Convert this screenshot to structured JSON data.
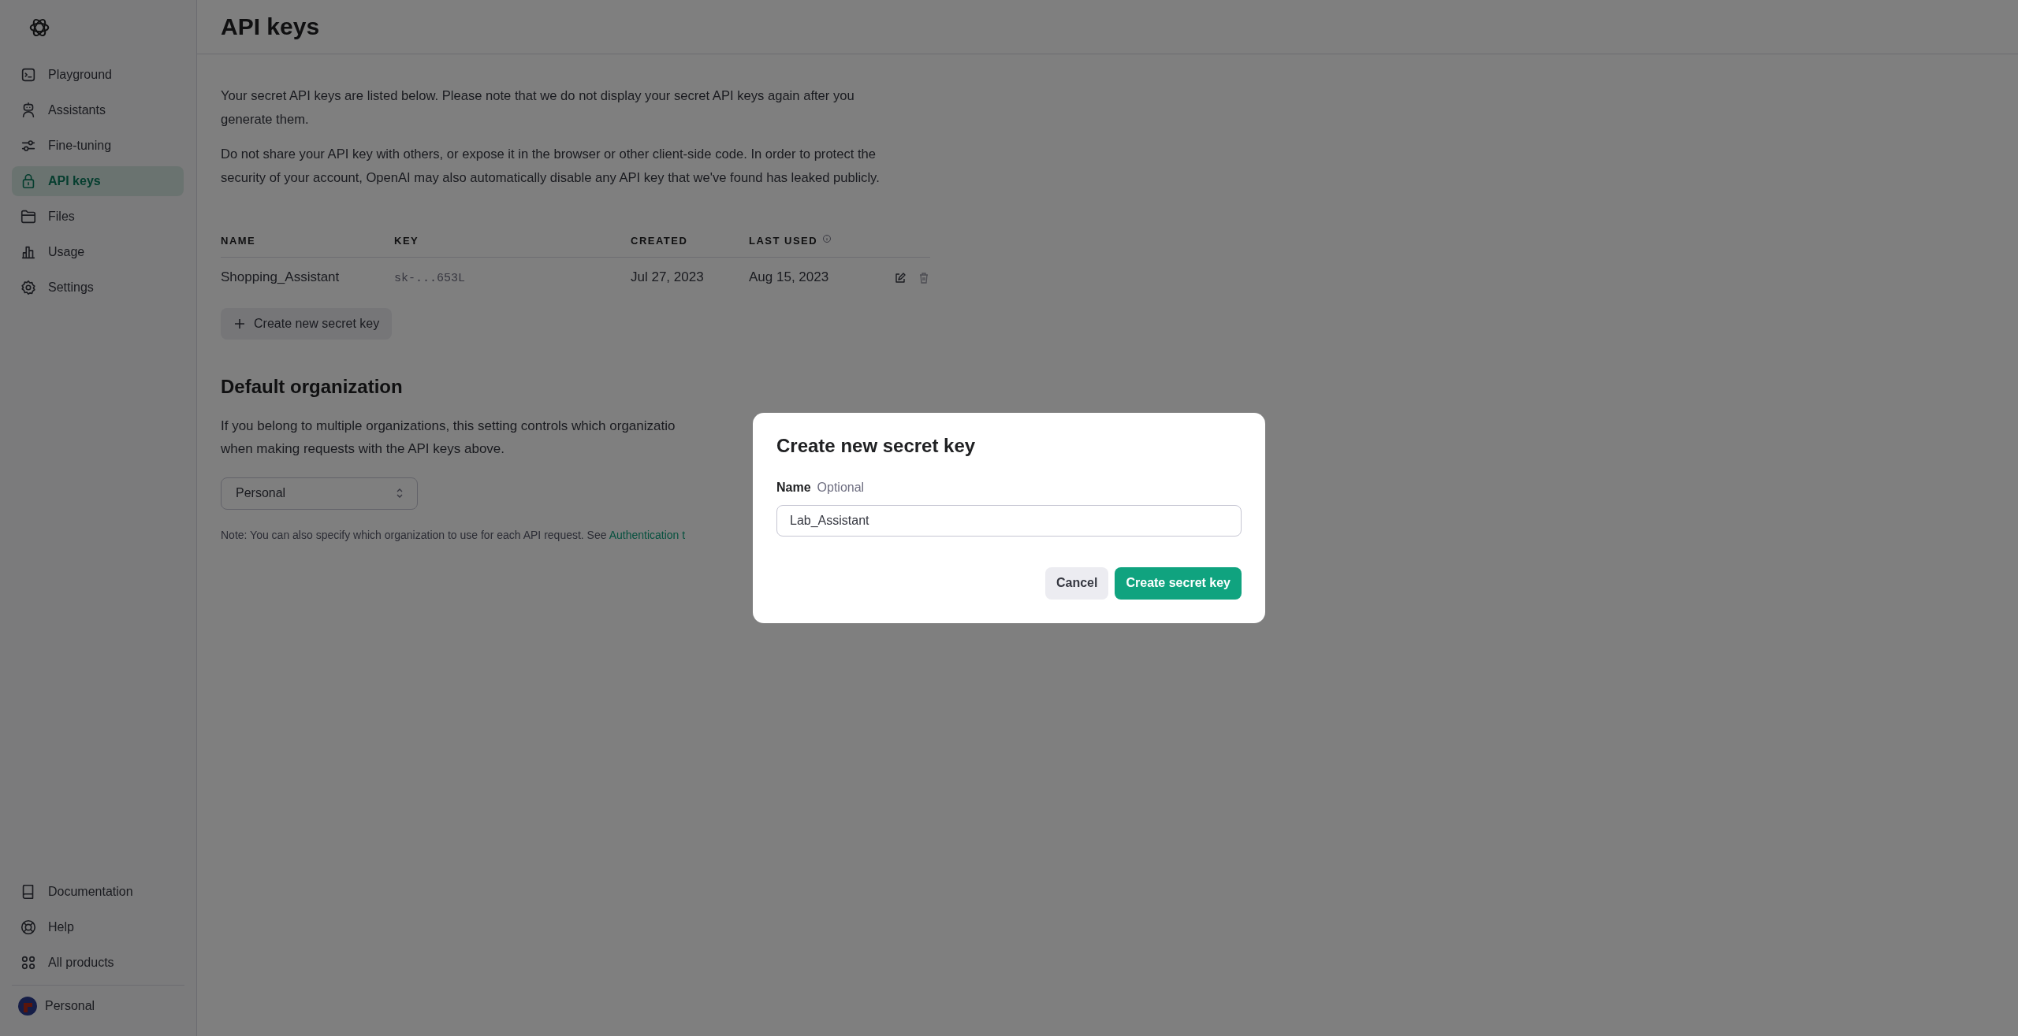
{
  "sidebar": {
    "items": [
      {
        "label": "Playground",
        "selected": false
      },
      {
        "label": "Assistants",
        "selected": false
      },
      {
        "label": "Fine-tuning",
        "selected": false
      },
      {
        "label": "API keys",
        "selected": true
      },
      {
        "label": "Files",
        "selected": false
      },
      {
        "label": "Usage",
        "selected": false
      },
      {
        "label": "Settings",
        "selected": false
      }
    ],
    "footer_items": [
      {
        "label": "Documentation"
      },
      {
        "label": "Help"
      },
      {
        "label": "All products"
      }
    ],
    "account": {
      "label": "Personal"
    }
  },
  "page": {
    "title": "API keys",
    "paragraphs": [
      "Your secret API keys are listed below. Please note that we do not display your secret API keys again after you generate them.",
      "Do not share your API key with others, or expose it in the browser or other client-side code. In order to protect the security of your account, OpenAI may also automatically disable any API key that we've found has leaked publicly."
    ],
    "table": {
      "columns": [
        {
          "label": "NAME",
          "info": false
        },
        {
          "label": "KEY",
          "info": false
        },
        {
          "label": "CREATED",
          "info": false
        },
        {
          "label": "LAST USED",
          "info": true
        }
      ],
      "rows": [
        {
          "name": "Shopping_Assistant",
          "key": "sk-...653L",
          "created": "Jul 27, 2023",
          "last_used": "Aug 15, 2023"
        }
      ]
    },
    "create_button": "Create new secret key",
    "org_section": {
      "title": "Default organization",
      "description_lines": [
        "If you belong to multiple organizations, this setting controls which organizatio",
        "when making requests with the API keys above."
      ],
      "select": {
        "value": "Personal"
      },
      "note": {
        "text": "Note: You can also specify which organization to use for each API request. See ",
        "link": "Authentication t"
      }
    }
  },
  "modal": {
    "title": "Create new secret key",
    "field": {
      "label": "Name",
      "hint": "Optional",
      "value": "Lab_Assistant"
    },
    "buttons": [
      {
        "label": "Cancel",
        "kind": "secondary"
      },
      {
        "label": "Create secret key",
        "kind": "primary"
      }
    ]
  }
}
